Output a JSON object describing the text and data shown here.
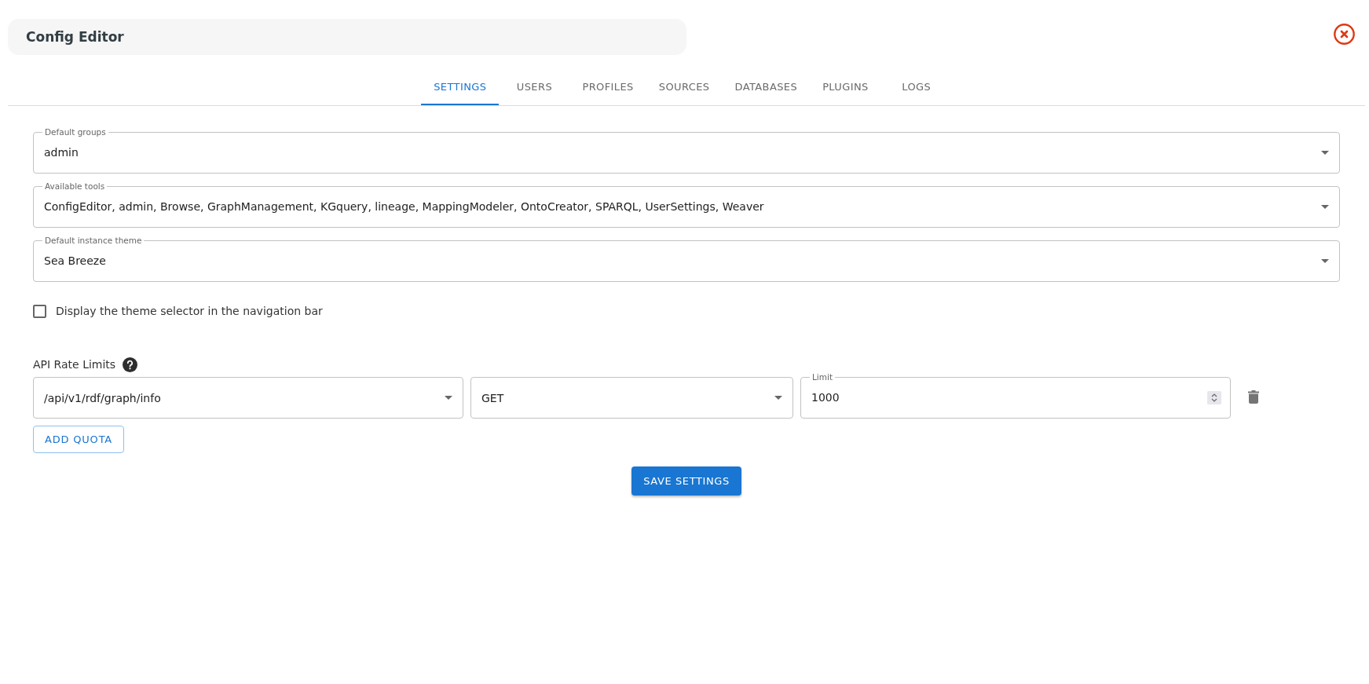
{
  "window": {
    "title": "Config Editor"
  },
  "tabs": [
    {
      "label": "SETTINGS",
      "selected": true
    },
    {
      "label": "USERS",
      "selected": false
    },
    {
      "label": "PROFILES",
      "selected": false
    },
    {
      "label": "SOURCES",
      "selected": false
    },
    {
      "label": "DATABASES",
      "selected": false
    },
    {
      "label": "PLUGINS",
      "selected": false
    },
    {
      "label": "LOGS",
      "selected": false
    }
  ],
  "settings": {
    "fields": [
      {
        "kind": "select",
        "label": "Default groups",
        "value": "admin"
      },
      {
        "kind": "select",
        "label": "Available tools",
        "value": "ConfigEditor, admin, Browse, GraphManagement, KGquery, lineage, MappingModeler, OntoCreator, SPARQL, UserSettings, Weaver"
      },
      {
        "kind": "select",
        "label": "Default instance theme",
        "value": "Sea Breeze"
      }
    ],
    "theme_selector": {
      "label": "Display the theme selector in the navigation bar",
      "checked": false
    },
    "rate_limits": {
      "title": "API Rate Limits",
      "quotas": [
        {
          "fields": [
            {
              "kind": "select",
              "value": "/api/v1/rdf/graph/info"
            },
            {
              "kind": "select",
              "value": "GET"
            },
            {
              "kind": "number",
              "label": "Limit",
              "value": "1000"
            }
          ]
        }
      ],
      "add_button": "ADD QUOTA"
    },
    "save_button": "SAVE SETTINGS"
  }
}
